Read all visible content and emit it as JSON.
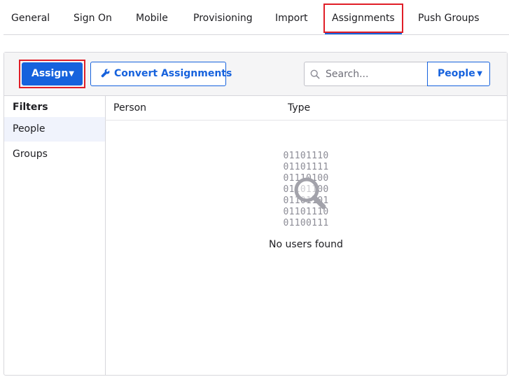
{
  "tabs": [
    {
      "label": "General",
      "active": false
    },
    {
      "label": "Sign On",
      "active": false
    },
    {
      "label": "Mobile",
      "active": false
    },
    {
      "label": "Provisioning",
      "active": false
    },
    {
      "label": "Import",
      "active": false
    },
    {
      "label": "Assignments",
      "active": true
    },
    {
      "label": "Push Groups",
      "active": false
    }
  ],
  "toolbar": {
    "assign_label": "Assign",
    "convert_label": "Convert Assignments",
    "search_placeholder": "Search...",
    "search_value": "",
    "scope_selected": "People"
  },
  "filters": {
    "title": "Filters",
    "items": [
      {
        "label": "People",
        "selected": true
      },
      {
        "label": "Groups",
        "selected": false
      }
    ]
  },
  "table": {
    "columns": [
      "Person",
      "Type"
    ]
  },
  "empty_state": {
    "binary_lines": [
      "01101110",
      "01101111",
      "01110100",
      "01101100",
      "01101101",
      "01101110",
      "01100111"
    ],
    "message": "No users found"
  },
  "colors": {
    "accent": "#1662dd",
    "highlight_border": "#e01e27",
    "toolbar_bg": "#f5f5f6",
    "selected_filter_bg": "#f0f3fc"
  },
  "icons": {
    "convert": "wrench-icon",
    "search": "search-icon",
    "caret": "caret-down-icon",
    "empty": "magnifier-icon"
  }
}
